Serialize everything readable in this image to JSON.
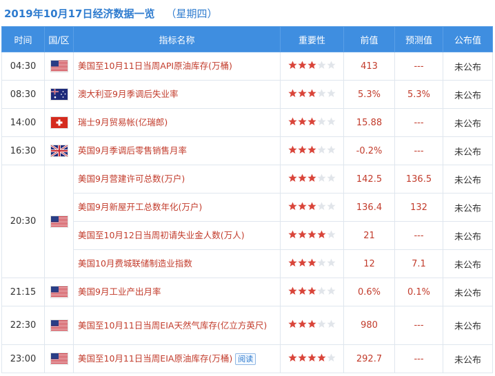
{
  "header": {
    "title": "2019年10月17日经济数据一览",
    "weekday": "（星期四）"
  },
  "columns": [
    "时间",
    "国/区",
    "指标名称",
    "重要性",
    "前值",
    "预测值",
    "公布值"
  ],
  "colors": {
    "accent": "#3f8ee0",
    "red_text": "#c23b2b",
    "star_on": "#d9453a",
    "star_off": "#e1e5ea"
  },
  "rows": [
    {
      "time": "04:30",
      "flag": "us-flag-icon",
      "name": "美国至10月11日当周API原油库存(万桶)",
      "importance": 3,
      "prev": "413",
      "forecast": "---",
      "published": "未公布"
    },
    {
      "time": "08:30",
      "flag": "au-flag-icon",
      "name": "澳大利亚9月季调后失业率",
      "importance": 3,
      "prev": "5.3%",
      "forecast": "5.3%",
      "published": "未公布"
    },
    {
      "time": "14:00",
      "flag": "ch-flag-icon",
      "name": "瑞士9月贸易帐(亿瑞郎)",
      "importance": 3,
      "prev": "15.88",
      "forecast": "---",
      "published": "未公布"
    },
    {
      "time": "16:30",
      "flag": "uk-flag-icon",
      "name": "英国9月季调后零售销售月率",
      "importance": 3,
      "prev": "-0.2%",
      "forecast": "---",
      "published": "未公布"
    },
    {
      "time": "20:30",
      "flag": "us-flag-icon",
      "name": "美国9月营建许可总数(万户)",
      "importance": 3,
      "prev": "142.5",
      "forecast": "136.5",
      "published": "未公布"
    },
    {
      "name": "美国9月新屋开工总数年化(万户)",
      "importance": 3,
      "prev": "136.4",
      "forecast": "132",
      "published": "未公布"
    },
    {
      "name": "美国至10月12日当周初请失业金人数(万人)",
      "importance": 4,
      "prev": "21",
      "forecast": "---",
      "published": "未公布"
    },
    {
      "name": "美国10月费城联储制造业指数",
      "importance": 3,
      "prev": "12",
      "forecast": "7.1",
      "published": "未公布"
    },
    {
      "time": "21:15",
      "flag": "us-flag-icon",
      "name": "美国9月工业产出月率",
      "importance": 3,
      "prev": "0.6%",
      "forecast": "0.1%",
      "published": "未公布"
    },
    {
      "time": "22:30",
      "flag": "us-flag-icon",
      "name": "美国至10月11日当周EIA天然气库存(亿立方英尺)",
      "importance": 3,
      "prev": "980",
      "forecast": "---",
      "published": "未公布"
    },
    {
      "time": "23:00",
      "flag": "us-flag-icon",
      "name": "美国至10月11日当周EIA原油库存(万桶)",
      "importance": 4,
      "prev": "292.7",
      "forecast": "---",
      "published": "未公布",
      "button": "阅读"
    }
  ]
}
